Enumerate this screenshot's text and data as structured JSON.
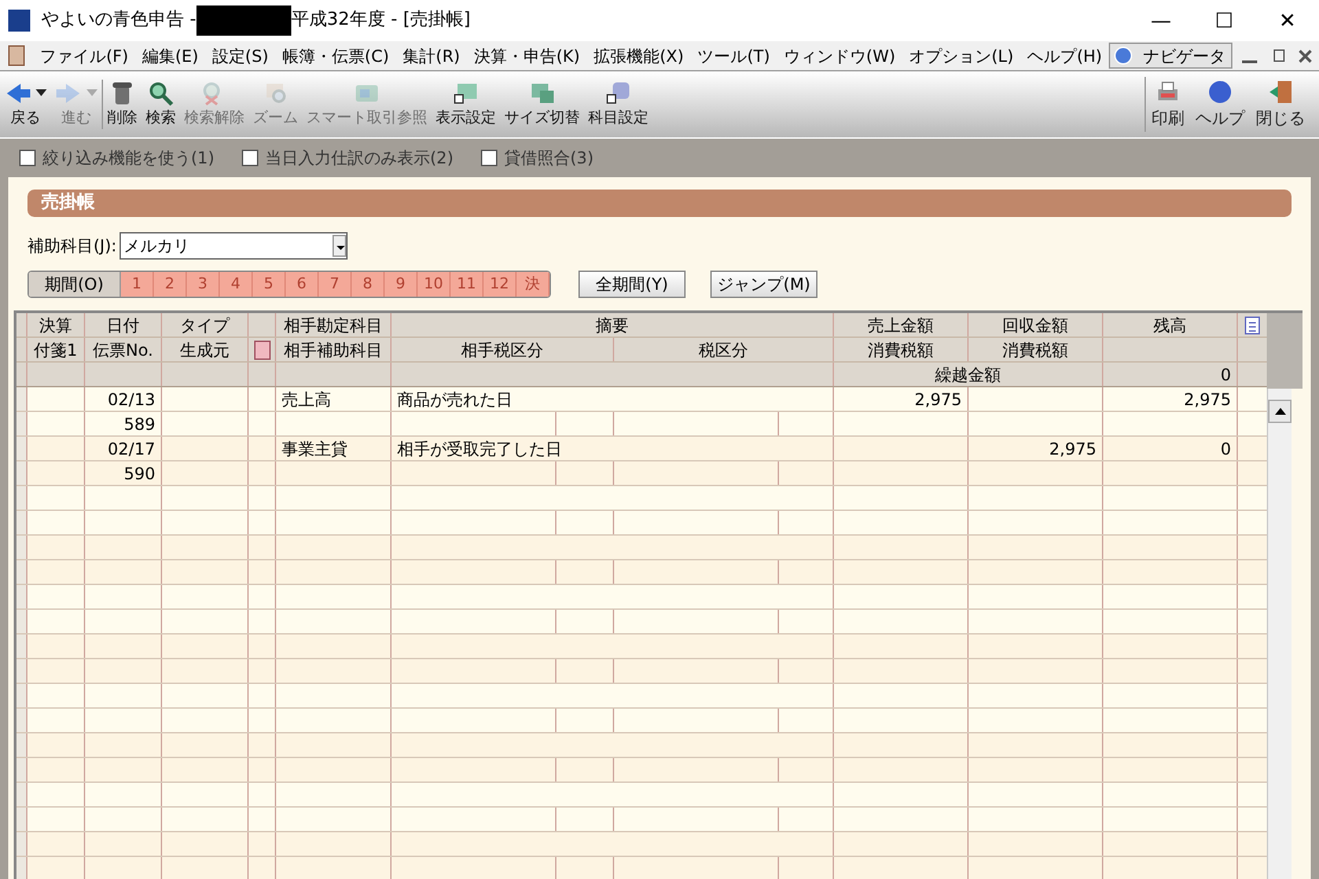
{
  "window": {
    "title_prefix": "やよいの青色申告 -",
    "title_suffix": "平成32年度 - [売掛帳]",
    "controls": [
      "—",
      "☐",
      "✕"
    ]
  },
  "menu": [
    "ファイル(F)",
    "編集(E)",
    "設定(S)",
    "帳簿・伝票(C)",
    "集計(R)",
    "決算・申告(K)",
    "拡張機能(X)",
    "ツール(T)",
    "ウィンドウ(W)",
    "オプション(L)",
    "ヘルプ(H)"
  ],
  "navigator": {
    "label": "ナビゲータ"
  },
  "toolbar": [
    {
      "label": "戻る",
      "disabled": false,
      "dropdown": true
    },
    {
      "label": "進む",
      "disabled": true,
      "dropdown": true
    },
    {
      "label": "削除",
      "disabled": false,
      "dropdown": false
    },
    {
      "label": "検索",
      "disabled": false,
      "dropdown": false
    },
    {
      "label": "検索解除",
      "disabled": true,
      "dropdown": false
    },
    {
      "label": "ズーム",
      "disabled": true,
      "dropdown": false
    },
    {
      "label": "スマート取引参照",
      "disabled": true,
      "dropdown": false
    },
    {
      "label": "表示設定",
      "disabled": false,
      "dropdown": false
    },
    {
      "label": "サイズ切替",
      "disabled": false,
      "dropdown": false
    },
    {
      "label": "科目設定",
      "disabled": false,
      "dropdown": false
    }
  ],
  "toolbar_right": [
    {
      "label": "印刷"
    },
    {
      "label": "ヘルプ"
    },
    {
      "label": "閉じる"
    }
  ],
  "options": [
    {
      "label": "絞り込み機能を使う(1)",
      "checked": false
    },
    {
      "label": "当日入力仕訳のみ表示(2)",
      "checked": false
    },
    {
      "label": "貸借照合(3)",
      "checked": false
    }
  ],
  "section_title": "売掛帳",
  "sub_account": {
    "label": "補助科目(J):",
    "value": "メルカリ"
  },
  "period": {
    "label": "期間(O)",
    "months": [
      "1",
      "2",
      "3",
      "4",
      "5",
      "6",
      "7",
      "8",
      "9",
      "10",
      "11",
      "12",
      "決"
    ]
  },
  "buttons": [
    "全期間(Y)",
    "ジャンプ(M)"
  ],
  "table": {
    "header_row_1": [
      "決算",
      "日付",
      "タイプ",
      "相手勘定科目",
      "摘要",
      "売上金額",
      "回収金額",
      "残高"
    ],
    "header_row_2": [
      "付箋1",
      "伝票No.",
      "生成元",
      "相手補助科目",
      "相手税区分",
      "税区分",
      "消費税額",
      "消費税額"
    ],
    "carry_forward": {
      "label": "繰越金額",
      "balance": "0"
    },
    "rows": [
      {
        "date": "02/13",
        "voucher": "589",
        "account": "売上高",
        "description": "商品が売れた日",
        "sales": "2,975",
        "collected": "",
        "balance": "2,975"
      },
      {
        "date": "02/17",
        "voucher": "590",
        "account": "事業主貸",
        "description": "相手が受取完了した日",
        "sales": "",
        "collected": "2,975",
        "balance": "0"
      }
    ]
  }
}
